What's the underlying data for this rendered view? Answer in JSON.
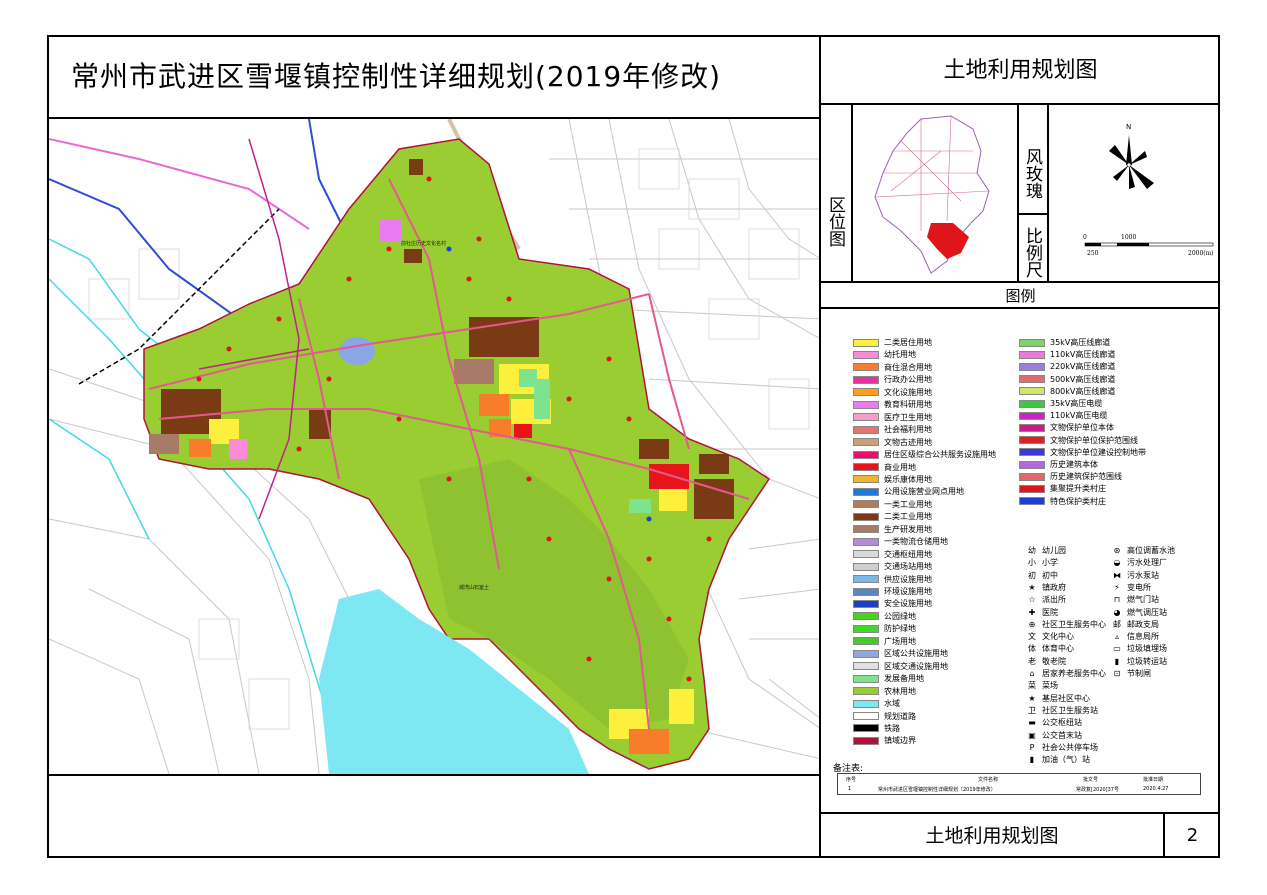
{
  "title": "常州市武进区雪堰镇控制性详细规划(2019年修改)",
  "right_title": "土地利用规划图",
  "location_label": "区位图",
  "rose_label": "风玫瑰",
  "north_mark": "N",
  "scale_label": "比例尺",
  "scale": {
    "t0": "0",
    "t250": "250",
    "t1000": "1000",
    "t2000": "2000(m)"
  },
  "legend_heading": "图例",
  "legend_left": [
    {
      "label": "二类居住用地",
      "color": "#ffef3d"
    },
    {
      "label": "幼托用地",
      "color": "#f98bd8"
    },
    {
      "label": "商住混合用地",
      "color": "#f77d2a"
    },
    {
      "label": "行政办公用地",
      "color": "#e6329e"
    },
    {
      "label": "文化设施用地",
      "color": "#ff9f1a"
    },
    {
      "label": "教育科研用地",
      "color": "#ea7bf0"
    },
    {
      "label": "医疗卫生用地",
      "color": "#f3a0c8"
    },
    {
      "label": "社会福利用地",
      "color": "#e57373"
    },
    {
      "label": "文物古迹用地",
      "color": "#c9a07a"
    },
    {
      "label": "居住区级综合公共服务设施用地",
      "color": "#f20a6e"
    },
    {
      "label": "商业用地",
      "color": "#e8141b"
    },
    {
      "label": "娱乐康体用地",
      "color": "#f0b52b"
    },
    {
      "label": "公用设施营业网点用地",
      "color": "#1f7ad6"
    },
    {
      "label": "一类工业用地",
      "color": "#b07b5b"
    },
    {
      "label": "二类工业用地",
      "color": "#7a3b14"
    },
    {
      "label": "生产研发用地",
      "color": "#a87b69"
    },
    {
      "label": "一类物流仓储用地",
      "color": "#b58bd9"
    },
    {
      "label": "交通枢纽用地",
      "color": "#d9d9d9"
    },
    {
      "label": "交通场站用地",
      "color": "#cfcfcf"
    },
    {
      "label": "供应设施用地",
      "color": "#7cb7e6"
    },
    {
      "label": "环境设施用地",
      "color": "#5a86c2"
    },
    {
      "label": "安全设施用地",
      "color": "#1a3fbf"
    },
    {
      "label": "公园绿地",
      "color": "#47d41f"
    },
    {
      "label": "防护绿地",
      "color": "#3fd92b"
    },
    {
      "label": "广场用地",
      "color": "#4ac92c"
    },
    {
      "label": "区域公共设施用地",
      "color": "#8fa6e0"
    },
    {
      "label": "区域交通设施用地",
      "color": "#e0e0e0"
    },
    {
      "label": "发展备用地",
      "color": "#7de38f"
    },
    {
      "label": "农林用地",
      "color": "#9acd32"
    },
    {
      "label": "水域",
      "color": "#7ee8f2"
    },
    {
      "label": "规划道路",
      "color": "#ffffff"
    },
    {
      "label": "铁路",
      "color": "#000000"
    },
    {
      "label": "镇域边界",
      "color": "#b1123a"
    }
  ],
  "legend_right": [
    {
      "label": "35kV高压线廊道",
      "color": "#7ed66a"
    },
    {
      "label": "110kV高压线廊道",
      "color": "#e87bd8"
    },
    {
      "label": "220kV高压线廊道",
      "color": "#9b7fe0"
    },
    {
      "label": "500kV高压线廊道",
      "color": "#e36a6a"
    },
    {
      "label": "800kV高压线廊道",
      "color": "#d0e86a"
    },
    {
      "label": "35kV高压电缆",
      "color": "#3cc83c"
    },
    {
      "label": "110kV高压电缆",
      "color": "#c02ac0"
    },
    {
      "label": "文物保护单位本体",
      "color": "#c91a8a"
    },
    {
      "label": "文物保护单位保护范围线",
      "color": "#e0201f"
    },
    {
      "label": "文物保护单位建设控制地带",
      "color": "#3a3adb"
    },
    {
      "label": "历史建筑本体",
      "color": "#b06ad9"
    },
    {
      "label": "历史建筑保护范围线",
      "color": "#e06a6a"
    },
    {
      "label": "集聚提升类村庄",
      "color": "#e0141b"
    },
    {
      "label": "特色保护类村庄",
      "color": "#1a3fdb"
    }
  ],
  "symbols_left": [
    {
      "glyph": "幼",
      "label": "幼儿园"
    },
    {
      "glyph": "小",
      "label": "小学"
    },
    {
      "glyph": "初",
      "label": "初中"
    },
    {
      "glyph": "★",
      "label": "镇政府"
    },
    {
      "glyph": "☆",
      "label": "派出所"
    },
    {
      "glyph": "✚",
      "label": "医院"
    },
    {
      "glyph": "⊕",
      "label": "社区卫生服务中心"
    },
    {
      "glyph": "文",
      "label": "文化中心"
    },
    {
      "glyph": "体",
      "label": "体育中心"
    },
    {
      "glyph": "老",
      "label": "敬老院"
    },
    {
      "glyph": "⌂",
      "label": "居家养老服务中心"
    },
    {
      "glyph": "菜",
      "label": "菜场"
    },
    {
      "glyph": "★",
      "label": "基层社区中心"
    },
    {
      "glyph": "卫",
      "label": "社区卫生服务站"
    },
    {
      "glyph": "▬",
      "label": "公交枢纽站"
    },
    {
      "glyph": "▣",
      "label": "公交首末站"
    },
    {
      "glyph": "P",
      "label": "社会公共停车场"
    },
    {
      "glyph": "▮",
      "label": "加油（气）站"
    }
  ],
  "symbols_right": [
    {
      "glyph": "⊛",
      "label": "高位调蓄水池"
    },
    {
      "glyph": "◒",
      "label": "污水处理厂"
    },
    {
      "glyph": "⧓",
      "label": "污水泵站"
    },
    {
      "glyph": "⚡",
      "label": "变电所"
    },
    {
      "glyph": "⊓",
      "label": "燃气门站"
    },
    {
      "glyph": "◕",
      "label": "燃气调压站"
    },
    {
      "glyph": "邮",
      "label": "邮政支局"
    },
    {
      "glyph": "▵",
      "label": "信息局所"
    },
    {
      "glyph": "▭",
      "label": "垃圾填埋场"
    },
    {
      "glyph": "▮",
      "label": "垃圾转运站"
    },
    {
      "glyph": "⊡",
      "label": "节制闸"
    }
  ],
  "remarks_label": "备注表:",
  "remarks_table": {
    "headers": [
      "序号",
      "文件名称",
      "批文号",
      "批准日期"
    ],
    "row": [
      "1",
      "常州市武进区雪堰镇控制性详细规划（2019年修改）",
      "常政复[2020]37号",
      "2020.4.27"
    ]
  },
  "map_labels": {
    "village": "前社庄历史文化名村",
    "mountain_area": "城湾山石室土",
    "mountain_name": "城湾山石室土地"
  },
  "footer_title": "土地利用规划图",
  "page_number": "2"
}
